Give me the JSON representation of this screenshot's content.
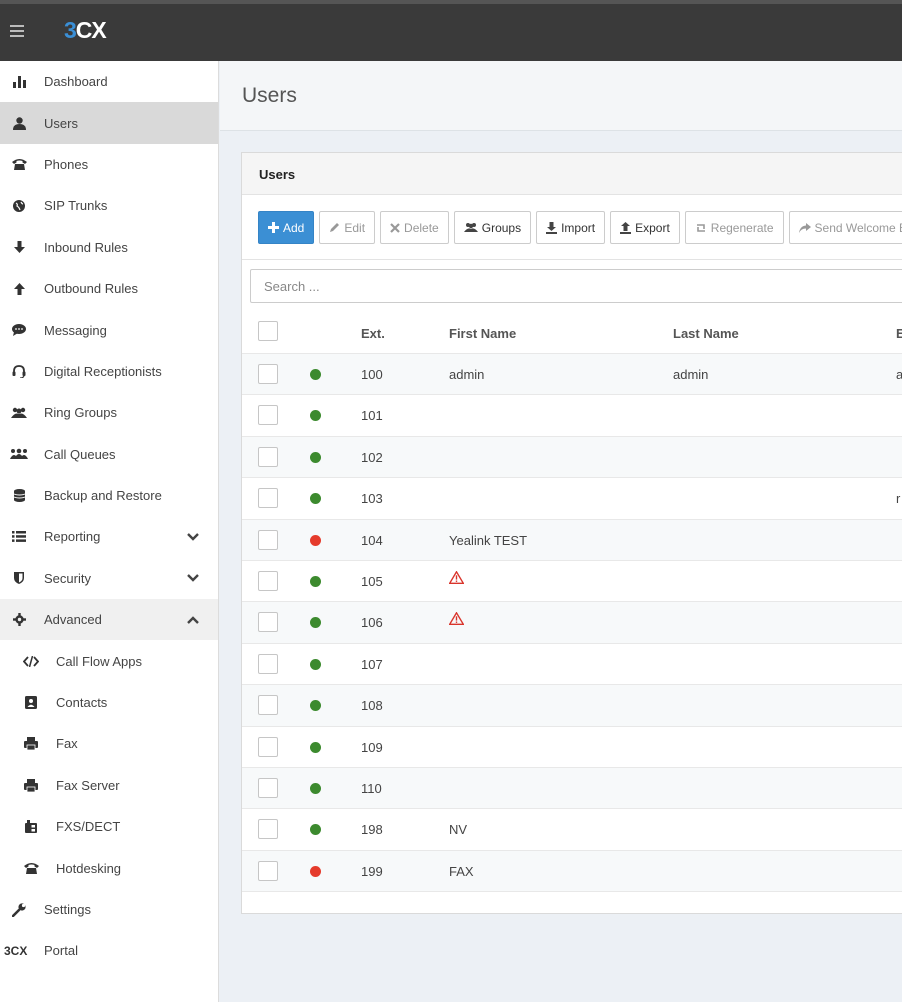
{
  "app": {
    "logo_prefix": "3",
    "logo_suffix": "CX"
  },
  "sidebar": {
    "items": [
      {
        "label": "Dashboard",
        "icon": "bar-chart-icon"
      },
      {
        "label": "Users",
        "icon": "user-icon",
        "active": true
      },
      {
        "label": "Phones",
        "icon": "phone-icon"
      },
      {
        "label": "SIP Trunks",
        "icon": "globe-icon"
      },
      {
        "label": "Inbound Rules",
        "icon": "arrow-down-icon"
      },
      {
        "label": "Outbound Rules",
        "icon": "arrow-up-icon"
      },
      {
        "label": "Messaging",
        "icon": "chat-bubble-icon"
      },
      {
        "label": "Digital Receptionists",
        "icon": "headset-icon"
      },
      {
        "label": "Ring Groups",
        "icon": "group-icon"
      },
      {
        "label": "Call Queues",
        "icon": "users-queue-icon"
      },
      {
        "label": "Backup and Restore",
        "icon": "database-icon"
      },
      {
        "label": "Reporting",
        "icon": "list-icon",
        "chevron": "down"
      },
      {
        "label": "Security",
        "icon": "shield-icon",
        "chevron": "down"
      },
      {
        "label": "Advanced",
        "icon": "gear-icon",
        "chevron": "up"
      },
      {
        "label": "Call Flow Apps",
        "icon": "code-icon",
        "sub": true
      },
      {
        "label": "Contacts",
        "icon": "contact-card-icon",
        "sub": true
      },
      {
        "label": "Fax",
        "icon": "fax-icon",
        "sub": true
      },
      {
        "label": "Fax Server",
        "icon": "fax-server-icon",
        "sub": true
      },
      {
        "label": "FXS/DECT",
        "icon": "fxs-device-icon",
        "sub": true
      },
      {
        "label": "Hotdesking",
        "icon": "desk-phone-icon",
        "sub": true
      },
      {
        "label": "Settings",
        "icon": "wrench-icon"
      },
      {
        "label": "Portal",
        "icon": "3cx-logo-icon",
        "icon_text": "3CX"
      }
    ]
  },
  "page": {
    "title": "Users"
  },
  "panel": {
    "title": "Users",
    "toolbar": {
      "add": "Add",
      "edit": "Edit",
      "delete": "Delete",
      "groups": "Groups",
      "import": "Import",
      "export": "Export",
      "regenerate": "Regenerate",
      "send_welcome": "Send Welcome E"
    },
    "search_placeholder": "Search ..."
  },
  "table": {
    "headers": {
      "ext": "Ext.",
      "first": "First Name",
      "last": "Last Name",
      "email": "E"
    },
    "rows": [
      {
        "ext": "100",
        "first": "admin",
        "last": "admin",
        "email": "a",
        "status": "online"
      },
      {
        "ext": "101",
        "first": "",
        "last": "",
        "email": "",
        "status": "online"
      },
      {
        "ext": "102",
        "first": "",
        "last": "",
        "email": "",
        "status": "online"
      },
      {
        "ext": "103",
        "first": "",
        "last": "",
        "email": "r",
        "status": "online"
      },
      {
        "ext": "104",
        "first": "Yealink TEST",
        "last": "",
        "email": "",
        "status": "offline"
      },
      {
        "ext": "105",
        "first": "",
        "last": "",
        "email": "",
        "status": "online",
        "warning": true
      },
      {
        "ext": "106",
        "first": "",
        "last": "",
        "email": "",
        "status": "online",
        "warning": true
      },
      {
        "ext": "107",
        "first": "",
        "last": "",
        "email": "",
        "status": "online"
      },
      {
        "ext": "108",
        "first": "",
        "last": "",
        "email": "",
        "status": "online"
      },
      {
        "ext": "109",
        "first": "",
        "last": "",
        "email": "",
        "status": "online"
      },
      {
        "ext": "110",
        "first": "",
        "last": "",
        "email": "",
        "status": "online"
      },
      {
        "ext": "198",
        "first": "NV",
        "last": "",
        "email": "",
        "status": "online"
      },
      {
        "ext": "199",
        "first": "FAX",
        "last": "",
        "email": "",
        "status": "offline"
      }
    ]
  },
  "colors": {
    "online": "#3c8a2e",
    "offline": "#e53b2c",
    "warning": "#d9342b",
    "accent": "#3b8fd4"
  }
}
